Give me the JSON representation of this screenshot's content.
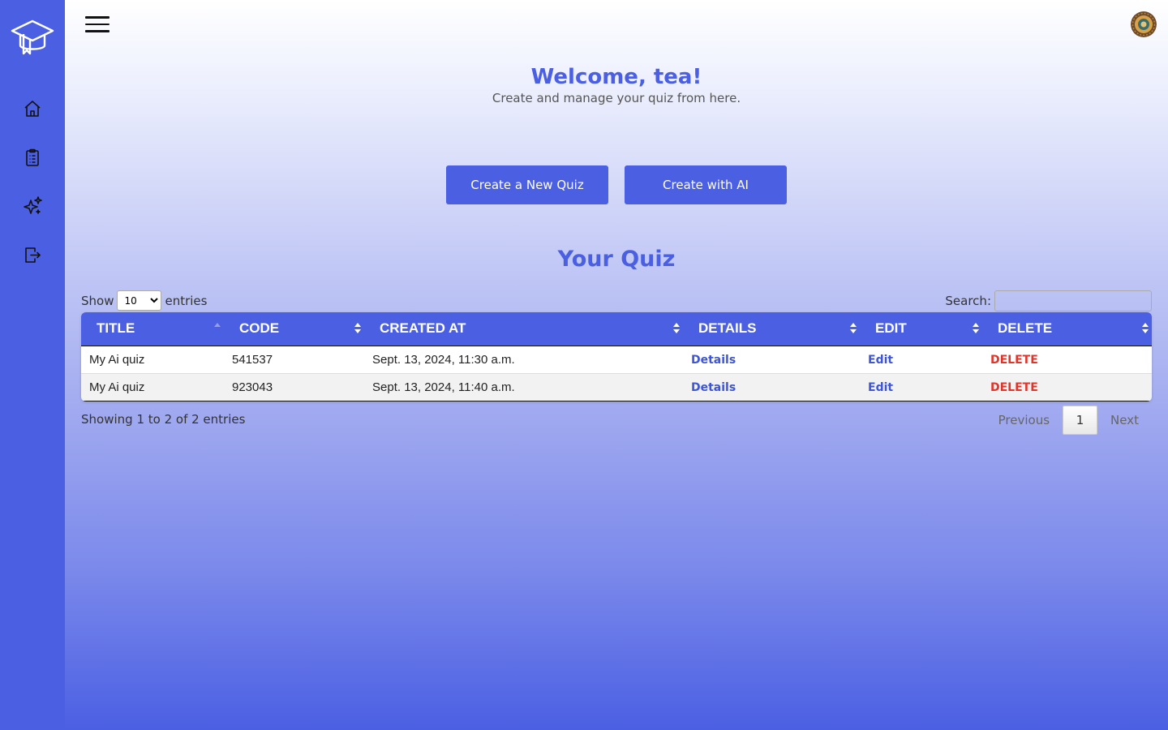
{
  "sidebar": {
    "logo": "graduation-cap-icon",
    "items": [
      {
        "icon": "home-icon"
      },
      {
        "icon": "clipboard-list-icon"
      },
      {
        "icon": "sparkles-icon"
      },
      {
        "icon": "logout-icon"
      }
    ]
  },
  "header": {
    "menu_icon": "hamburger-icon",
    "avatar": "avatar"
  },
  "welcome": {
    "title": "Welcome, tea!",
    "subtitle": "Create and manage your quiz from here."
  },
  "actions": {
    "new_quiz": "Create a New Quiz",
    "ai_quiz": "Create with AI"
  },
  "quiz_section": {
    "title": "Your Quiz"
  },
  "table_controls": {
    "show_label": "Show",
    "entries_value": "10",
    "entries_label": "entries",
    "search_label": "Search:",
    "search_value": ""
  },
  "table": {
    "columns": [
      "TITLE",
      "CODE",
      "CREATED AT",
      "DETAILS",
      "EDIT",
      "DELETE"
    ],
    "rows": [
      {
        "title": "My Ai quiz",
        "code": "541537",
        "created_at": "Sept. 13, 2024, 11:30 a.m.",
        "details": "Details",
        "edit": "Edit",
        "delete": "DELETE"
      },
      {
        "title": "My Ai quiz",
        "code": "923043",
        "created_at": "Sept. 13, 2024, 11:40 a.m.",
        "details": "Details",
        "edit": "Edit",
        "delete": "DELETE"
      }
    ]
  },
  "footer": {
    "info": "Showing 1 to 2 of 2 entries",
    "previous": "Previous",
    "page": "1",
    "next": "Next"
  },
  "colors": {
    "accent": "#4b5fe3",
    "delete": "#e0352b",
    "link": "#3d55d6"
  }
}
